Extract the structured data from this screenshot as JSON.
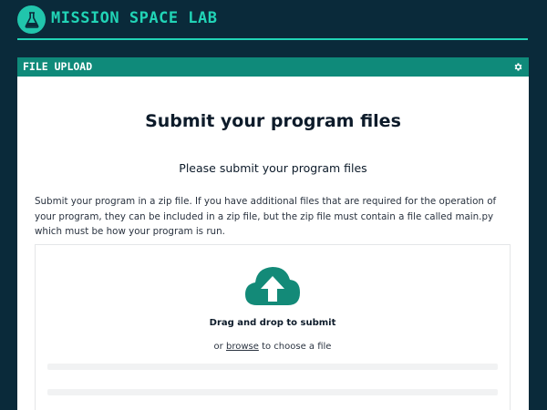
{
  "app": {
    "title": "MISSION SPACE LAB",
    "logo_icon": "flask-icon"
  },
  "panel": {
    "header": "FILE UPLOAD",
    "settings_icon": "gear-icon"
  },
  "content": {
    "title": "Submit your program files",
    "subtitle": "Please submit your program files",
    "description": "Submit your program in a zip file. If you have additional files that are required for the operation of your program, they can be included in a zip file, but the zip file must contain a file called main.py which must be how your program is run."
  },
  "dropzone": {
    "icon": "cloud-upload-icon",
    "drag_text": "Drag and drop to submit",
    "or_text": "or",
    "browse_label": "browse",
    "choose_text": "to choose a file"
  },
  "colors": {
    "background": "#0a2a3a",
    "accent": "#21d4b6",
    "header": "#0f8a7a",
    "icon": "#138a78"
  }
}
